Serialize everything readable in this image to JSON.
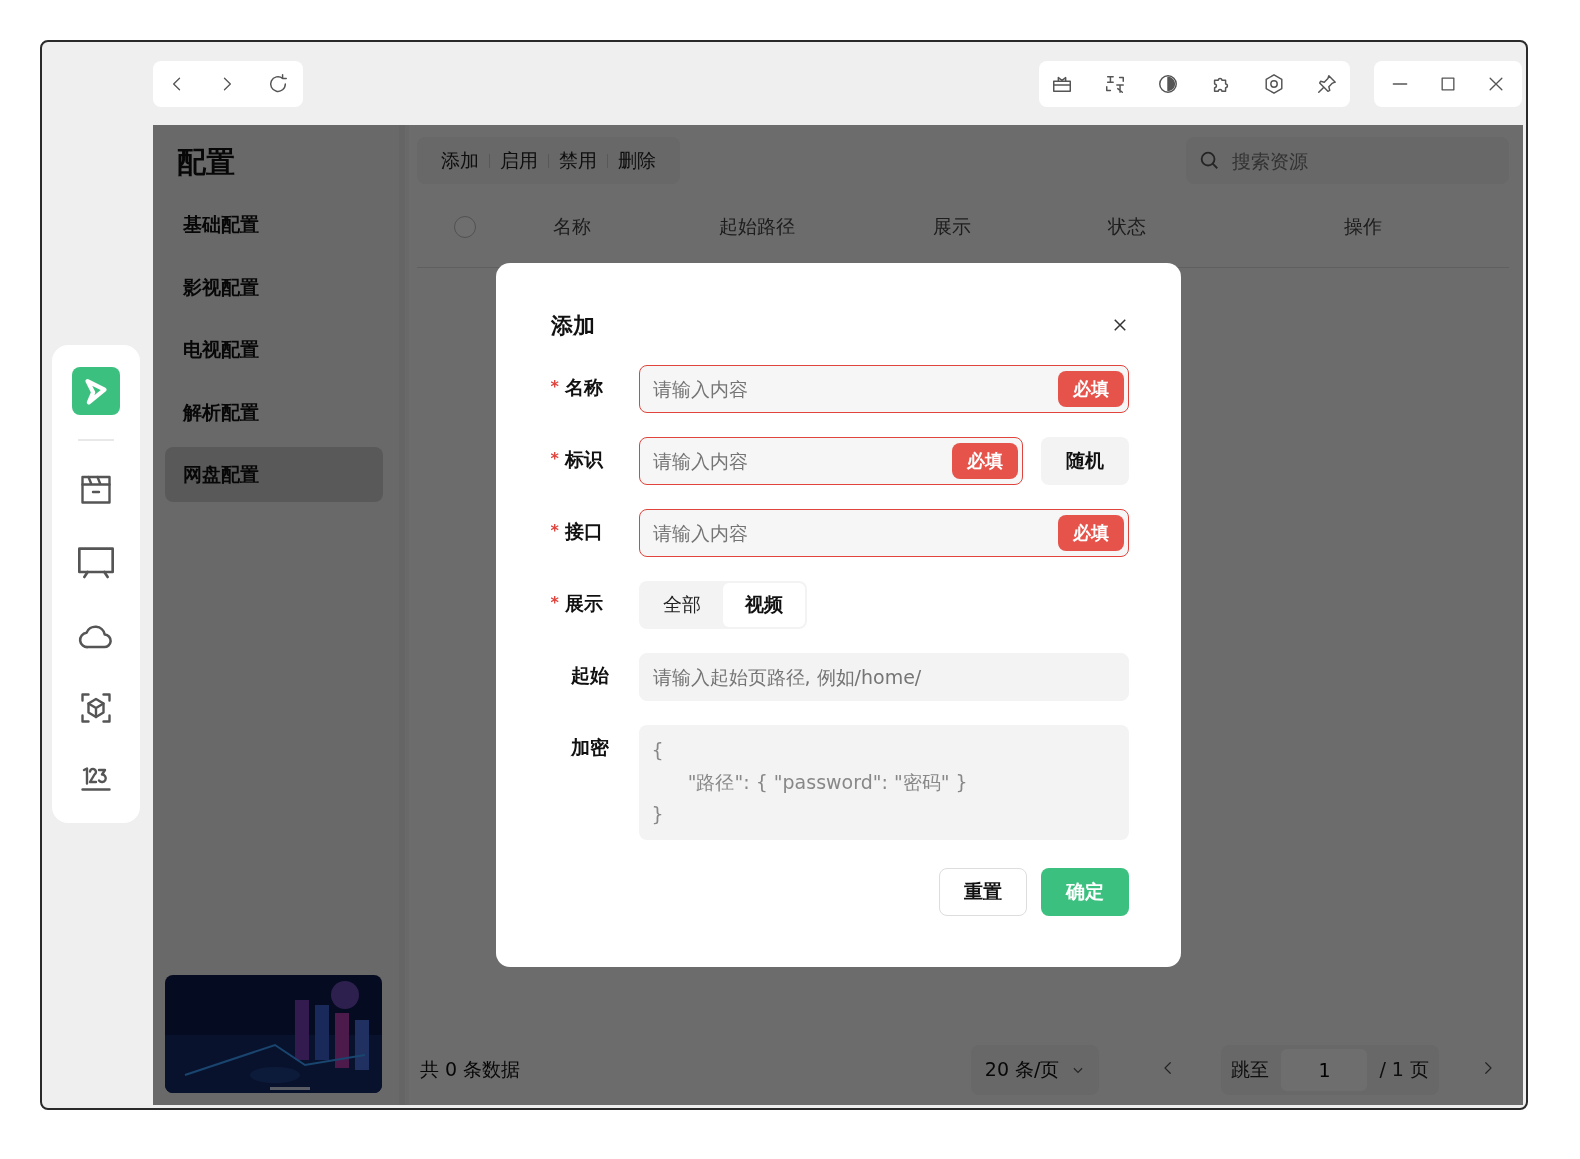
{
  "config_menu": {
    "title": "配置",
    "items": [
      {
        "label": "基础配置",
        "selected": false
      },
      {
        "label": "影视配置",
        "selected": false
      },
      {
        "label": "电视配置",
        "selected": false
      },
      {
        "label": "解析配置",
        "selected": false
      },
      {
        "label": "网盘配置",
        "selected": true
      }
    ]
  },
  "toolbar": {
    "actions": [
      "添加",
      "启用",
      "禁用",
      "删除"
    ],
    "search": {
      "placeholder": "搜索资源"
    }
  },
  "table": {
    "select_all_checked": false,
    "columns": [
      "名称",
      "起始路径",
      "展示",
      "状态",
      "操作"
    ]
  },
  "pagination": {
    "total": "共 0 条数据",
    "page_size": "20 条/页",
    "jump_label": "跳至",
    "page": "1",
    "page_count": "/ 1 页"
  },
  "dialog": {
    "title": "添加",
    "fields": [
      {
        "kind": "input",
        "label": "名称",
        "required_mark": "*",
        "error": true,
        "placeholder": "请输入内容",
        "badge": "必填"
      },
      {
        "kind": "input",
        "label": "标识",
        "required_mark": "*",
        "error": true,
        "placeholder": "请输入内容",
        "badge": "必填",
        "button": "随机"
      },
      {
        "kind": "input",
        "label": "接口",
        "required_mark": "*",
        "error": true,
        "placeholder": "请输入内容",
        "badge": "必填"
      },
      {
        "kind": "segmented",
        "label": "展示",
        "required_mark": "*",
        "options": [
          {
            "label": "全部",
            "selected": false
          },
          {
            "label": "视频",
            "selected": true
          }
        ]
      },
      {
        "kind": "input",
        "label": "起始",
        "error": false,
        "placeholder": "请输入起始页路径, 例如/home/"
      },
      {
        "kind": "textarea",
        "label": "加密",
        "placeholder": "{\n      \"路径\": { \"password\": \"密码\" }\n}"
      }
    ],
    "buttons": [
      {
        "label": "重置",
        "kind": "default"
      },
      {
        "label": "确定",
        "kind": "primary"
      }
    ]
  }
}
